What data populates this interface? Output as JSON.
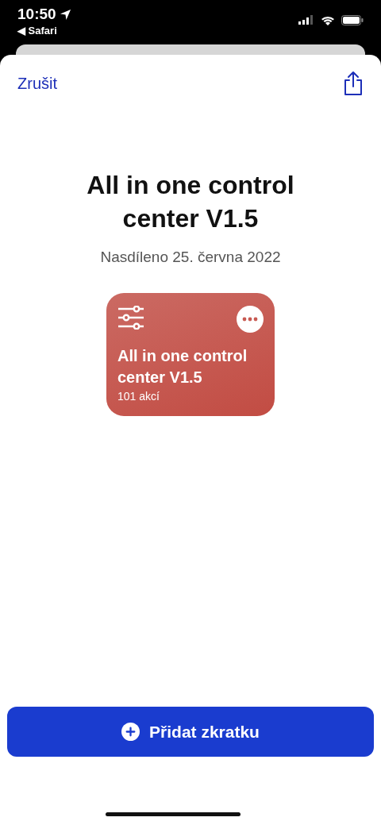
{
  "status_bar": {
    "time": "10:50",
    "back_app": "◀ Safari"
  },
  "sheet": {
    "cancel": "Zrušit",
    "title": "All in one control center V1.5",
    "shared": "Nasdíleno 25. června 2022"
  },
  "shortcut": {
    "name": "All in one control center V1.5",
    "actions": "101 akcí"
  },
  "add_button": {
    "label": "Přidat zkratku"
  }
}
